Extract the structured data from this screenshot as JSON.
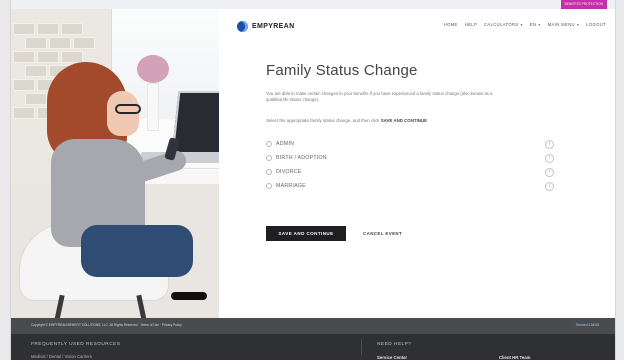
{
  "topbar": {
    "tag_text": "BENEFITS PROTECTION"
  },
  "brand": {
    "name": "EMPYREAN"
  },
  "nav": {
    "items": [
      {
        "label": "HOME"
      },
      {
        "label": "HELP"
      },
      {
        "label": "CALCULATORS"
      },
      {
        "label": "EN"
      },
      {
        "label": "MAIN MENU"
      },
      {
        "label": "LOGOUT"
      }
    ]
  },
  "main": {
    "title": "Family Status Change",
    "description": "You are able to make certain changes to your benefits if you have experienced a family status change (also known as a qualified life status change).",
    "instruction_prefix": "Select the appropriate family status change, and then click ",
    "instruction_strong": "SAVE AND CONTINUE",
    "options": [
      {
        "label": "ADMIN"
      },
      {
        "label": "BIRTH / ADOPTION"
      },
      {
        "label": "DIVORCE"
      },
      {
        "label": "MARRIAGE"
      }
    ],
    "save_button_label": "SAVE AND CONTINUE",
    "cancel_button_label": "CANCEL EVENT"
  },
  "footer": {
    "copyright_text": "Copyright © EMPYREAN BENEFIT SOLUTIONS, LLC. All Rights Reserved · Terms of Use · Privacy Policy",
    "security_text_prefix": "Secured",
    "security_text_suffix": "2.04.03",
    "resources_title": "FREQUENTLY USED RESOURCES",
    "resources_item": "Medical / Dental / Vision Carriers",
    "help_title": "NEED HELP?",
    "service_center": "Service Center",
    "hr_team": "Client HR Team"
  }
}
